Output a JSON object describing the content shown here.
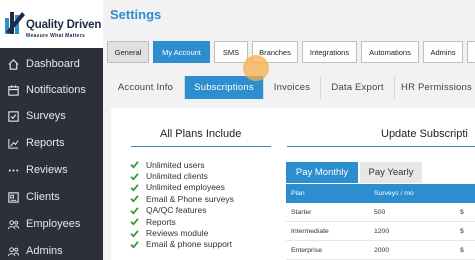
{
  "sidebar": {
    "logo": {
      "name": "Quality Driven",
      "tagline": "Measure What Matters"
    },
    "items": [
      {
        "label": "Dashboard",
        "icon": "home-icon"
      },
      {
        "label": "Notifications",
        "icon": "calendar-icon"
      },
      {
        "label": "Surveys",
        "icon": "checkbox-icon"
      },
      {
        "label": "Reports",
        "icon": "chart-icon"
      },
      {
        "label": "Reviews",
        "icon": "dots-icon"
      },
      {
        "label": "Clients",
        "icon": "id-card-icon"
      },
      {
        "label": "Employees",
        "icon": "users-icon"
      },
      {
        "label": "Admins",
        "icon": "admins-icon"
      }
    ]
  },
  "page": {
    "title": "Settings"
  },
  "top_tabs": [
    "General",
    "My Account",
    "SMS",
    "Branches",
    "Integrations",
    "Automations",
    "Admins",
    ""
  ],
  "sub_tabs": [
    "Account Info",
    "Subscriptions",
    "Invoices",
    "Data Export",
    "HR Permissions"
  ],
  "plans": {
    "title": "All Plans Include",
    "features": [
      "Unlimited users",
      "Unlimited clients",
      "Unlimited employees",
      "Email & Phone surveys",
      "QA/QC features",
      "Reports",
      "Reviews module",
      "Email & phone support"
    ]
  },
  "update": {
    "title": "Update Subscripti",
    "pay_tabs": [
      "Pay Monthly",
      "Pay Yearly"
    ],
    "table": {
      "headers": [
        "Plan",
        "Surveys / mo",
        ""
      ],
      "rows": [
        [
          "Starter",
          "500",
          "$"
        ],
        [
          "Intermediate",
          "1200",
          "$"
        ],
        [
          "Enterprise",
          "2000",
          "$"
        ]
      ]
    }
  },
  "colors": {
    "accent": "#2d8ecf",
    "sidebar": "#2c3038",
    "check": "#2e9b3a"
  }
}
